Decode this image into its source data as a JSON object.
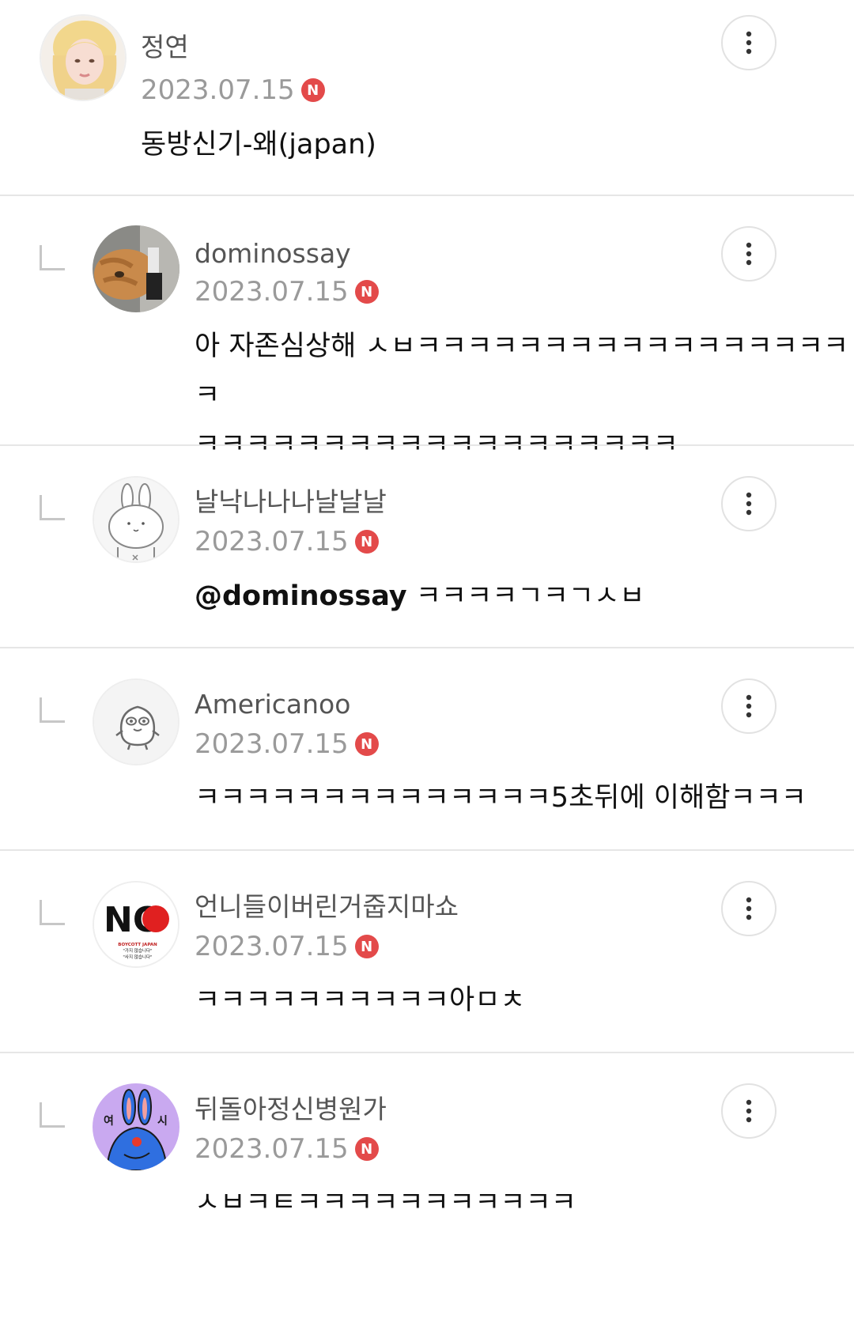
{
  "comments": [
    {
      "author": "정연",
      "date": "2023.07.15",
      "badge": "N",
      "text": "동방신기-왜(japan)",
      "is_reply": false,
      "avatar": "photo-avatar"
    },
    {
      "author": "dominossay",
      "date": "2023.07.15",
      "badge": "N",
      "text": "아 자존심상해 ㅅㅂㅋㅋㅋㅋㅋㅋㅋㅋㅋㅋㅋㅋㅋㅋㅋㅋㅋㅋ\nㅋㅋㅋㅋㅋㅋㅋㅋㅋㅋㅋㅋㅋㅋㅋㅋㅋㅋㅋ",
      "is_reply": true,
      "avatar": "cat-photo-avatar"
    },
    {
      "author": "날낙나나나날날날",
      "date": "2023.07.15",
      "badge": "N",
      "mention": "@dominossay",
      "text": " ㅋㅋㅋㅋㄱㅋㄱㅅㅂ",
      "is_reply": true,
      "avatar": "bunny-drawing-avatar"
    },
    {
      "author": "Americanoo",
      "date": "2023.07.15",
      "badge": "N",
      "text": "ㅋㅋㅋㅋㅋㅋㅋㅋㅋㅋㅋㅋㅋㅋ5초뒤에 이해함ㅋㅋㅋ",
      "is_reply": true,
      "avatar": "default-character-avatar"
    },
    {
      "author": "언니들이버린거줍지마쇼",
      "date": "2023.07.15",
      "badge": "N",
      "text": "ㅋㅋㅋㅋㅋㅋㅋㅋㅋㅋ아ㅁㅊ",
      "is_reply": true,
      "avatar": "no-boycott-avatar",
      "avatar_text": {
        "logo": "NO",
        "line1": "BOYCOTT JAPAN",
        "line2": "\"가지 않습니다\"",
        "line3": "\"사지 않습니다\""
      }
    },
    {
      "author": "뒤돌아정신병원가",
      "date": "2023.07.15",
      "badge": "N",
      "text": "ㅅㅂㅋㅌㅋㅋㅋㅋㅋㅋㅋㅋㅋㅋㅋ",
      "is_reply": true,
      "avatar": "rabbit-illustration-avatar",
      "avatar_text": {
        "left": "여",
        "right": "시"
      }
    }
  ],
  "colors": {
    "badge": "#e34a4a",
    "date": "#9a9a9a",
    "author": "#555555",
    "divider": "#e6e6e6"
  },
  "icons": {
    "more": "more-vertical-icon",
    "reply": "reply-indent-icon",
    "new": "new-badge"
  }
}
